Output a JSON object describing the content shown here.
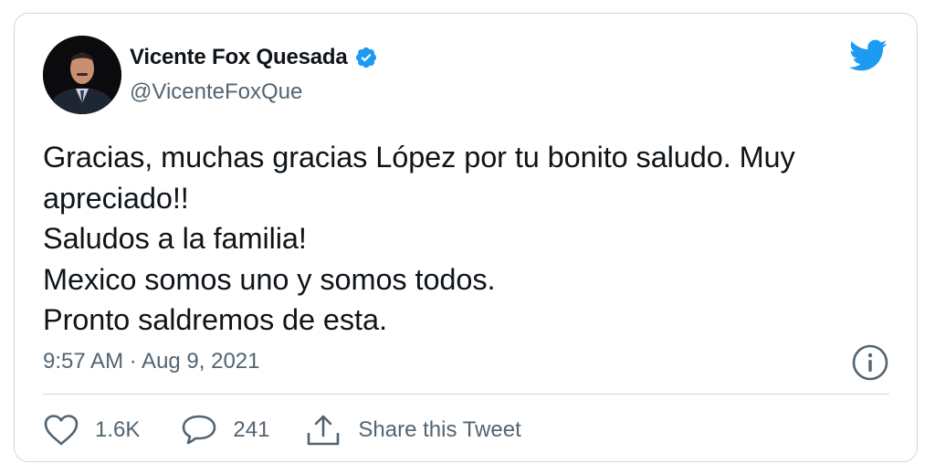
{
  "user": {
    "display_name": "Vicente Fox Quesada",
    "handle": "@VicenteFoxQue",
    "avatar_icon": "profile-photo",
    "verified_icon": "verified-badge-icon"
  },
  "tweet": {
    "lines": [
      "Gracias, muchas gracias López por tu bonito saludo. Muy",
      "apreciado!!",
      "Saludos a la familia!",
      "Mexico somos uno y somos todos.",
      "Pronto saldremos de esta."
    ],
    "timestamp": "9:57 AM · Aug 9, 2021"
  },
  "actions": {
    "like_count": "1.6K",
    "reply_count": "241",
    "share_label": "Share this Tweet"
  },
  "colors": {
    "brand_blue": "#1d9bf0",
    "secondary_text": "#536471",
    "border": "#cfd9de"
  }
}
